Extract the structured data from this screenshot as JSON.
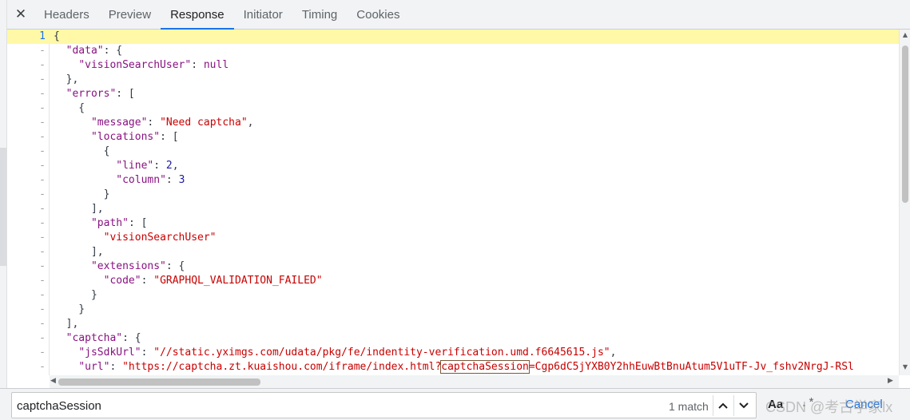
{
  "tabs": {
    "close_glyph": "✕",
    "items": [
      {
        "label": "Headers",
        "active": false
      },
      {
        "label": "Preview",
        "active": false
      },
      {
        "label": "Response",
        "active": true
      },
      {
        "label": "Initiator",
        "active": false
      },
      {
        "label": "Timing",
        "active": false
      },
      {
        "label": "Cookies",
        "active": false
      }
    ]
  },
  "editor": {
    "current_line_number": "1",
    "collapsed_marker": "-",
    "lines": [
      [
        {
          "t": "{",
          "c": "p"
        }
      ],
      [
        {
          "t": "  ",
          "c": "p"
        },
        {
          "t": "\"data\"",
          "c": "k"
        },
        {
          "t": ": {",
          "c": "p"
        }
      ],
      [
        {
          "t": "    ",
          "c": "p"
        },
        {
          "t": "\"visionSearchUser\"",
          "c": "k"
        },
        {
          "t": ": ",
          "c": "p"
        },
        {
          "t": "null",
          "c": "k"
        }
      ],
      [
        {
          "t": "  },",
          "c": "p"
        }
      ],
      [
        {
          "t": "  ",
          "c": "p"
        },
        {
          "t": "\"errors\"",
          "c": "k"
        },
        {
          "t": ": [",
          "c": "p"
        }
      ],
      [
        {
          "t": "    {",
          "c": "p"
        }
      ],
      [
        {
          "t": "      ",
          "c": "p"
        },
        {
          "t": "\"message\"",
          "c": "k"
        },
        {
          "t": ": ",
          "c": "p"
        },
        {
          "t": "\"Need captcha\"",
          "c": "s"
        },
        {
          "t": ",",
          "c": "p"
        }
      ],
      [
        {
          "t": "      ",
          "c": "p"
        },
        {
          "t": "\"locations\"",
          "c": "k"
        },
        {
          "t": ": [",
          "c": "p"
        }
      ],
      [
        {
          "t": "        {",
          "c": "p"
        }
      ],
      [
        {
          "t": "          ",
          "c": "p"
        },
        {
          "t": "\"line\"",
          "c": "k"
        },
        {
          "t": ": ",
          "c": "p"
        },
        {
          "t": "2",
          "c": "n"
        },
        {
          "t": ",",
          "c": "p"
        }
      ],
      [
        {
          "t": "          ",
          "c": "p"
        },
        {
          "t": "\"column\"",
          "c": "k"
        },
        {
          "t": ": ",
          "c": "p"
        },
        {
          "t": "3",
          "c": "n"
        }
      ],
      [
        {
          "t": "        }",
          "c": "p"
        }
      ],
      [
        {
          "t": "      ],",
          "c": "p"
        }
      ],
      [
        {
          "t": "      ",
          "c": "p"
        },
        {
          "t": "\"path\"",
          "c": "k"
        },
        {
          "t": ": [",
          "c": "p"
        }
      ],
      [
        {
          "t": "        ",
          "c": "p"
        },
        {
          "t": "\"visionSearchUser\"",
          "c": "s"
        }
      ],
      [
        {
          "t": "      ],",
          "c": "p"
        }
      ],
      [
        {
          "t": "      ",
          "c": "p"
        },
        {
          "t": "\"extensions\"",
          "c": "k"
        },
        {
          "t": ": {",
          "c": "p"
        }
      ],
      [
        {
          "t": "        ",
          "c": "p"
        },
        {
          "t": "\"code\"",
          "c": "k"
        },
        {
          "t": ": ",
          "c": "p"
        },
        {
          "t": "\"GRAPHQL_VALIDATION_FAILED\"",
          "c": "s"
        }
      ],
      [
        {
          "t": "      }",
          "c": "p"
        }
      ],
      [
        {
          "t": "    }",
          "c": "p"
        }
      ],
      [
        {
          "t": "  ],",
          "c": "p"
        }
      ],
      [
        {
          "t": "  ",
          "c": "p"
        },
        {
          "t": "\"captcha\"",
          "c": "k"
        },
        {
          "t": ": {",
          "c": "p"
        }
      ],
      [
        {
          "t": "    ",
          "c": "p"
        },
        {
          "t": "\"jsSdkUrl\"",
          "c": "k"
        },
        {
          "t": ": ",
          "c": "p"
        },
        {
          "t": "\"//static.yximgs.com/udata/pkg/fe/indentity-verification.umd.f6645615.js\"",
          "c": "s"
        },
        {
          "t": ",",
          "c": "p"
        }
      ],
      [
        {
          "t": "    ",
          "c": "p"
        },
        {
          "t": "\"url\"",
          "c": "k"
        },
        {
          "t": ": ",
          "c": "p"
        },
        {
          "t": "\"https://captcha.zt.kuaishou.com/iframe/index.html?",
          "c": "s"
        },
        {
          "t": "captchaSession",
          "c": "s",
          "hl": true
        },
        {
          "t": "=Cgp6dC5jYXB0Y2hhEuwBtBnuAtum5V1uTF-Jv_fshv2NrgJ-RSl",
          "c": "s"
        }
      ],
      [
        {
          "t": "  }",
          "c": "p"
        }
      ]
    ]
  },
  "search": {
    "value": "captchaSession",
    "match_count": "1 match",
    "case_label": "Aa",
    "regex_label": ".*",
    "cancel_label": "Cancel",
    "watermark": "CSDN @考古学家lx"
  },
  "colors": {
    "accent": "#1a73e8",
    "current_line": "#fff8a6",
    "key": "#881280",
    "string": "#c80000",
    "number": "#1a1aa6"
  }
}
